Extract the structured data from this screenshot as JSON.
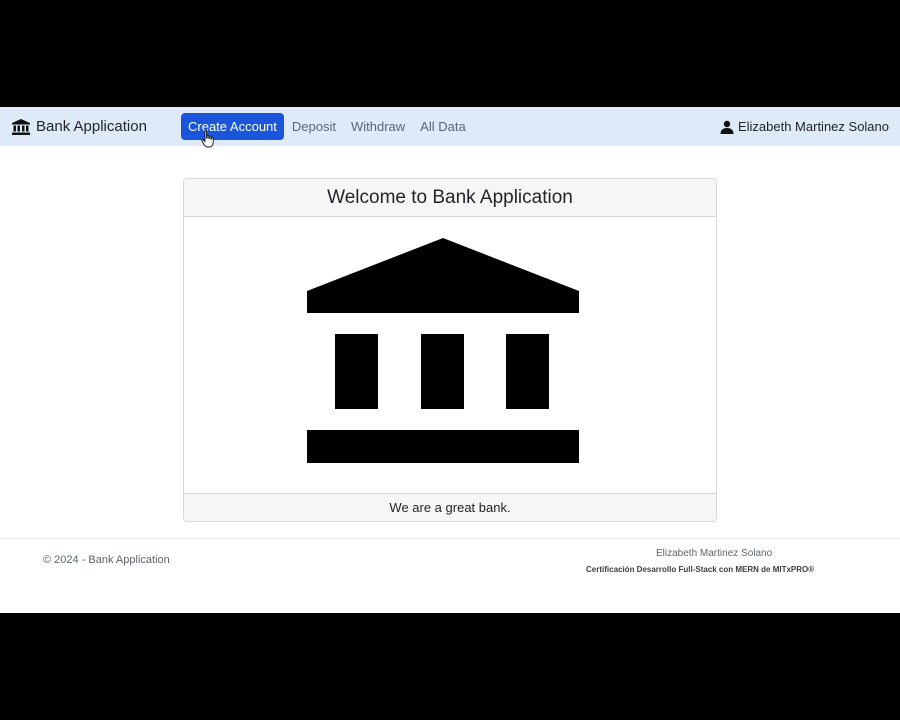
{
  "navbar": {
    "brand": "Bank Application",
    "brand_icon": "bank-icon",
    "links": [
      {
        "label": "Create Account",
        "active": true
      },
      {
        "label": "Deposit",
        "active": false
      },
      {
        "label": "Withdraw",
        "active": false
      },
      {
        "label": "All Data",
        "active": false
      }
    ],
    "user_name": "Elizabeth Martinez Solano",
    "user_icon": "person-icon",
    "active_color": "#1a56db",
    "background_color": "#dfeaf9"
  },
  "card": {
    "title": "Welcome to Bank Application",
    "image_icon": "bank-building-icon",
    "footer_text": "We are a great bank."
  },
  "footer": {
    "copyright": "© 2024 - Bank Application",
    "author": "Elizabeth Martinez Solano",
    "certification": "Certificación Desarrollo Full-Stack con MERN de MITxPRO®"
  }
}
